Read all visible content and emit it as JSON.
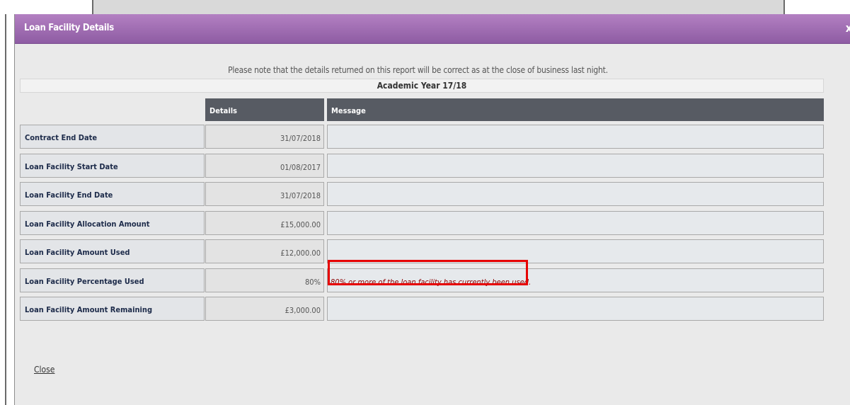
{
  "dialog": {
    "title": "Loan Facility Details",
    "close_glyph": "x",
    "note": "Please note that the details returned on this report will be correct as at the close of business last night.",
    "academic_year": "Academic Year 17/18",
    "columns": {
      "details": "Details",
      "message": "Message"
    },
    "rows": [
      {
        "label": "Contract End Date",
        "value": "31/07/2018",
        "message": ""
      },
      {
        "label": "Loan Facility Start Date",
        "value": "01/08/2017",
        "message": ""
      },
      {
        "label": "Loan Facility End Date",
        "value": "31/07/2018",
        "message": ""
      },
      {
        "label": "Loan Facility Allocation Amount",
        "value": "£15,000.00",
        "message": ""
      },
      {
        "label": "Loan Facility Amount Used",
        "value": "£12,000.00",
        "message": ""
      },
      {
        "label": "Loan Facility Percentage Used",
        "value": "80%",
        "message": "80% or more of the loan facility has currently been used."
      },
      {
        "label": "Loan Facility Amount Remaining",
        "value": "£3,000.00",
        "message": ""
      }
    ],
    "close_link": "Close"
  },
  "colors": {
    "title_bar": "#9b6ab0",
    "header": "#575b63",
    "warning_text": "#8b0000",
    "highlight_box": "#e60000"
  }
}
